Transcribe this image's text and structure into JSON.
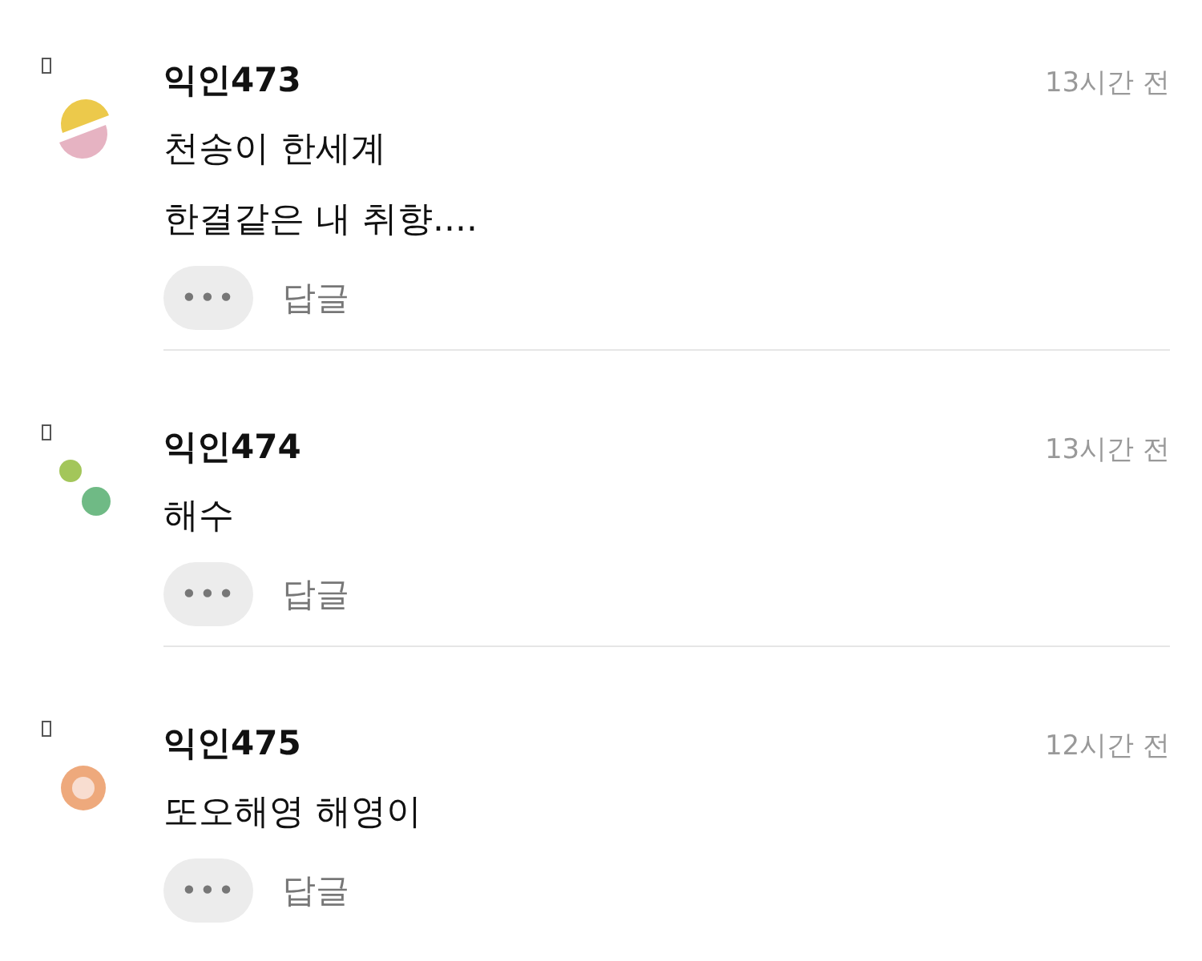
{
  "comments": [
    {
      "author": "익인473",
      "time": "13시간 전",
      "avatar": {
        "kind": "halves"
      },
      "lines": [
        "천송이 한세계",
        "한결같은 내 취향...."
      ],
      "more": "•••",
      "reply": "답글"
    },
    {
      "author": "익인474",
      "time": "13시간 전",
      "avatar": {
        "kind": "dots"
      },
      "lines": [
        "해수"
      ],
      "more": "•••",
      "reply": "답글"
    },
    {
      "author": "익인475",
      "time": "12시간 전",
      "avatar": {
        "kind": "ring"
      },
      "lines": [
        "또오해영 해영이"
      ],
      "more": "•••",
      "reply": "답글"
    }
  ]
}
